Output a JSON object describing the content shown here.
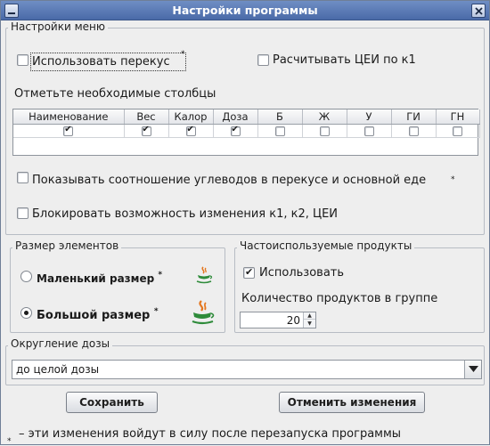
{
  "window": {
    "title": "Настройки программы",
    "buttons": [
      "minimize",
      "close"
    ]
  },
  "menu_settings": {
    "group_title": "Настройки меню",
    "use_snack": {
      "label": "Использовать перекус",
      "star": "*",
      "checked": false
    },
    "calc_cei": {
      "label": "Расчитывать ЦЕИ по к1",
      "checked": false
    },
    "columns_label": "Отметьте необходимые столбцы",
    "columns": [
      {
        "name": "Наименование",
        "checked": true
      },
      {
        "name": "Вес",
        "checked": true
      },
      {
        "name": "Калор",
        "checked": true
      },
      {
        "name": "Доза",
        "checked": true
      },
      {
        "name": "Б",
        "checked": false
      },
      {
        "name": "Ж",
        "checked": false
      },
      {
        "name": "У",
        "checked": false
      },
      {
        "name": "ГИ",
        "checked": false
      },
      {
        "name": "ГН",
        "checked": false
      }
    ],
    "show_ratio": {
      "label": "Показывать соотношение углеводов в перекусе и основной еде",
      "star": "*",
      "checked": false
    },
    "block_change": {
      "label": "Блокировать возможность изменения к1, к2, ЦЕИ",
      "checked": false
    }
  },
  "element_size": {
    "group_title": "Размер элементов",
    "small": {
      "label": "Маленький размер",
      "star": "*",
      "selected": false
    },
    "large": {
      "label": "Большой размер",
      "star": "*",
      "selected": true
    }
  },
  "frequent_products": {
    "group_title": "Частоиспользуемые продукты",
    "use": {
      "label": "Использовать",
      "checked": true
    },
    "count_label": "Количество продуктов в группе",
    "count_value": "20"
  },
  "dose_rounding": {
    "group_title": "Округление дозы",
    "selected": "до целой дозы"
  },
  "actions": {
    "save": "Сохранить",
    "cancel": "Отменить изменения"
  },
  "footnote": {
    "star": "*",
    "text": "– эти изменения войдут в силу после перезапуска программы"
  },
  "colors": {
    "titlebar_start": "#6f8ec4",
    "titlebar_end": "#4a6aa8",
    "window_bg": "#eeeeee",
    "java_orange": "#e4761e",
    "java_green": "#2e8b3a"
  }
}
